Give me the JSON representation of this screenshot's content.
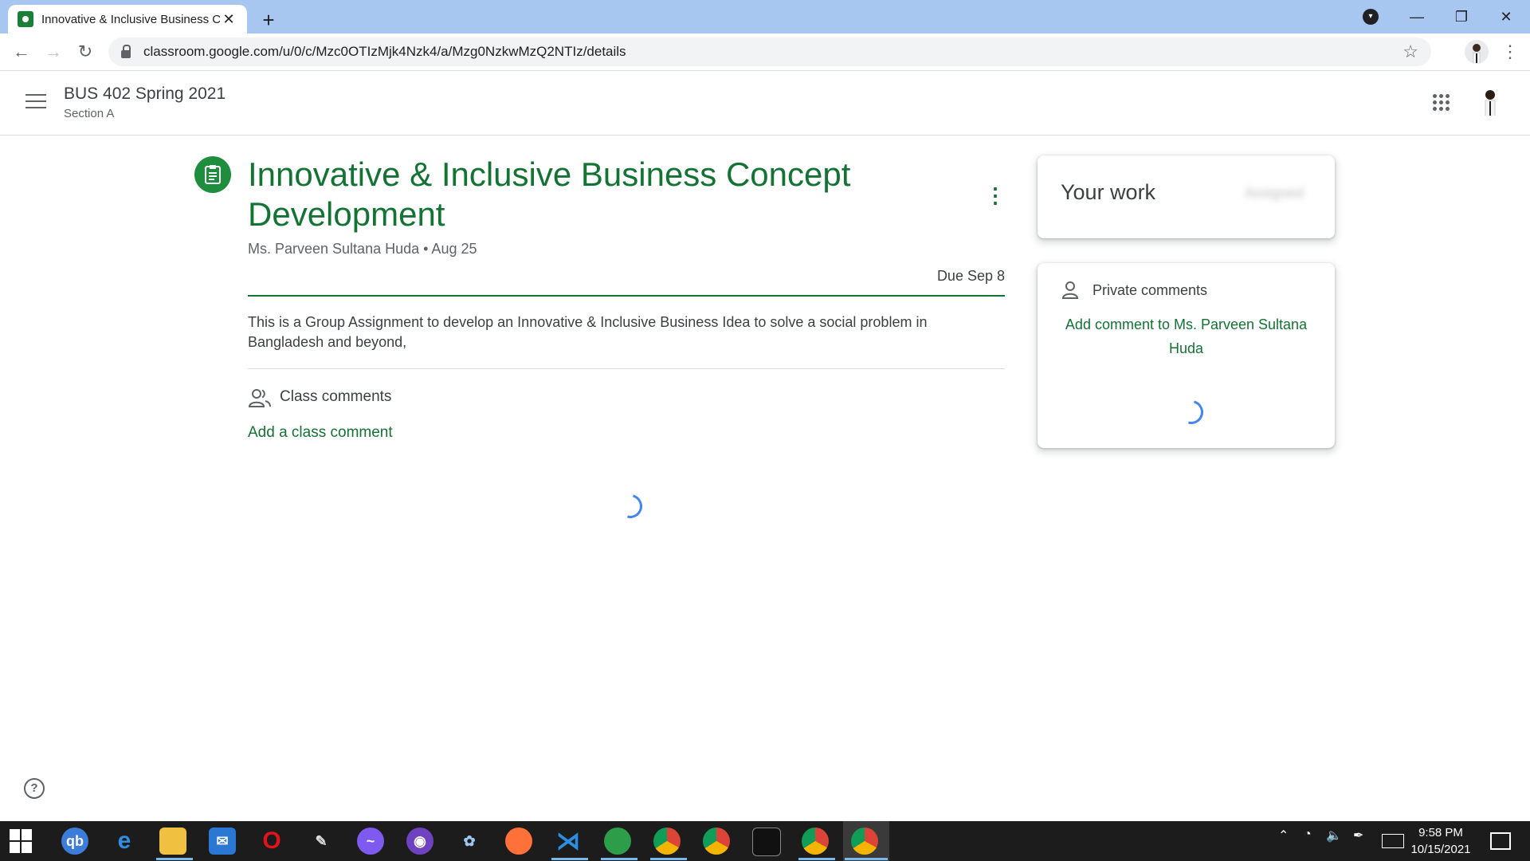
{
  "browser": {
    "tab_title": "Innovative & Inclusive Business C",
    "tab_close": "✕",
    "new_tab": "+",
    "url": "classroom.google.com/u/0/c/Mzc0OTIzMjk4Nzk4/a/Mzg0NzkwMzQ2NTIz/details",
    "window_minimize": "—",
    "window_restore": "❐",
    "window_close": "✕"
  },
  "classroom_header": {
    "class_name": "BUS 402 Spring 2021",
    "section": "Section A"
  },
  "assignment": {
    "title": "Innovative & Inclusive Business Concept Development",
    "author_date": "Ms. Parveen Sultana Huda • Aug 25",
    "due": "Due Sep 8",
    "description": "This is a Group Assignment to develop an Innovative & Inclusive Business Idea to solve a social problem in Bangladesh and beyond,",
    "class_comments_label": "Class comments",
    "add_class_comment": "Add a class comment"
  },
  "your_work": {
    "title": "Your work",
    "status": "Assigned"
  },
  "private_comments": {
    "label": "Private comments",
    "add_comment": "Add comment to Ms. Parveen Sultana Huda"
  },
  "help": "?",
  "taskbar": {
    "time": "9:58 PM",
    "date": "10/15/2021",
    "apps": [
      "qbittorrent-icon",
      "edge-icon",
      "file-explorer-icon",
      "mail-icon",
      "opera-icon",
      "inkscape-icon",
      "messenger-icon",
      "github-icon",
      "paint-icon",
      "firefox-icon",
      "vscode-icon",
      "app-icon",
      "chrome-icon",
      "chrome-icon",
      "terminal-icon",
      "chrome-icon",
      "chrome-icon"
    ]
  },
  "colors": {
    "accent_green": "#137333",
    "icon_green": "#1e8e3e",
    "spinner_blue": "#4285f4",
    "tab_strip": "#a7c7f1",
    "taskbar": "#1c1c1c"
  }
}
